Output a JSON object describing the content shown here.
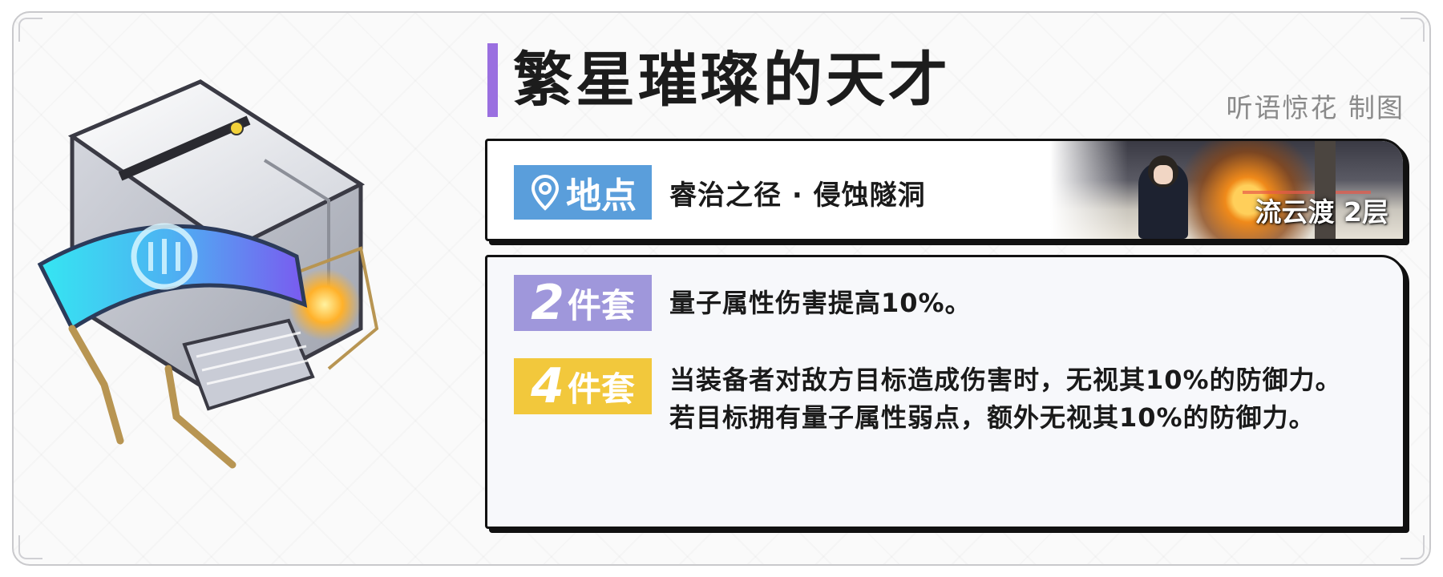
{
  "title": "繁星璀璨的天才",
  "credit": "听语惊花 制图",
  "location": {
    "tag_label": "地点",
    "name": "睿治之径 · 侵蚀隧洞",
    "scene_label": "流云渡 2层"
  },
  "sets": [
    {
      "count": "2",
      "label": "件套",
      "color": "#9f97db",
      "effect_lines": [
        "量子属性伤害提高10%。"
      ]
    },
    {
      "count": "4",
      "label": "件套",
      "color": "#f2c83c",
      "effect_lines": [
        "当装备者对敌方目标造成伤害时，无视其10%的防御力。",
        "若目标拥有量子属性弱点，额外无视其10%的防御力。"
      ]
    }
  ],
  "colors": {
    "title_accent": "#9a6fe0",
    "location_tag": "#5a9edb"
  }
}
